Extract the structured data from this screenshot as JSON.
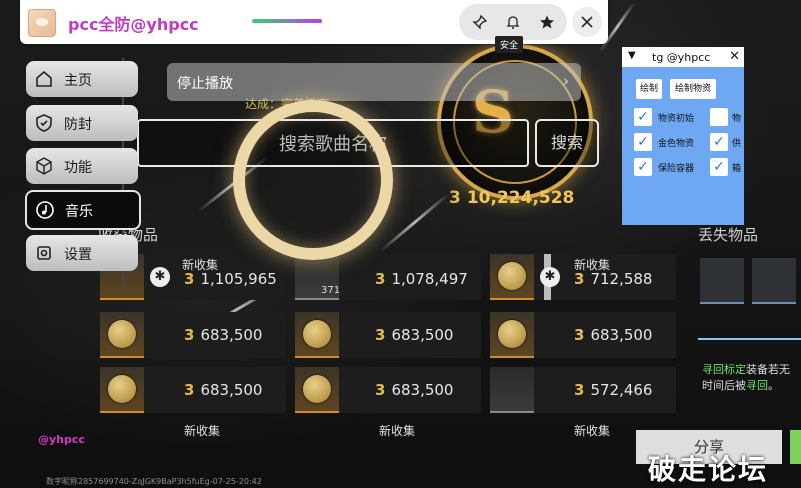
{
  "titlebar": {
    "app_title": "pcc全防@yhpcc",
    "tooltip": "安全",
    "icons": [
      "pin-icon",
      "bell-icon",
      "star-icon",
      "close-icon"
    ]
  },
  "sidebar": {
    "items": [
      {
        "label": "主页",
        "icon": "home-icon",
        "active": false
      },
      {
        "label": "防封",
        "icon": "shield-icon",
        "active": false
      },
      {
        "label": "功能",
        "icon": "cube-icon",
        "active": false
      },
      {
        "label": "音乐",
        "icon": "music-icon",
        "active": true
      },
      {
        "label": "设置",
        "icon": "settings-icon",
        "active": false
      }
    ]
  },
  "music": {
    "stop_label": "停止播放",
    "search_placeholder": "搜索歌曲名称",
    "search_button": "搜索",
    "sub_text": "达成：完美撤离"
  },
  "game": {
    "total_value": "10,224,528",
    "coin_symbol": "3",
    "collected_title": "收获物品",
    "lost_title": "丢失物品",
    "collected": [
      {
        "new": "新收集",
        "value": "1,105,965",
        "icon": "gold-statue-icon"
      },
      {
        "new": "",
        "value": "1,078,497",
        "icon": "baton-icon",
        "count": "371"
      },
      {
        "new": "新收集",
        "value": "712,588",
        "icon": "medal-icon"
      },
      {
        "value": "683,500",
        "icon": "coin-icon"
      },
      {
        "value": "683,500",
        "icon": "coin-icon"
      },
      {
        "value": "683,500",
        "icon": "coin-icon"
      },
      {
        "value": "683,500",
        "icon": "coin-icon"
      },
      {
        "value": "683,500",
        "icon": "coin-icon"
      },
      {
        "value": "572,466",
        "icon": "rifle-icon"
      }
    ],
    "lost_items": [
      "helmet-icon",
      "armor-icon"
    ],
    "retrieve_text_1_prefix": "寻回标定",
    "retrieve_text_1_suffix": "装备若无",
    "retrieve_text_2_prefix": "时间后被",
    "retrieve_text_2_link": "寻回",
    "retrieve_text_2_suffix": "。",
    "bottom_new_label": "新收集"
  },
  "panel": {
    "title": "tg @yhpcc",
    "tabs": [
      "绘制",
      "绘制物资"
    ],
    "options": [
      {
        "label": "物资初始",
        "checked": true
      },
      {
        "label": "金色物资",
        "checked": true
      },
      {
        "label": "保险容器",
        "checked": true
      }
    ],
    "options_right": [
      {
        "label": "物",
        "checked": false
      },
      {
        "label": "供",
        "checked": true
      },
      {
        "label": "箱",
        "checked": true
      }
    ]
  },
  "footer": {
    "tag": "@yhpcc",
    "id_text": "数字昵称2857699740-ZqJGK9BaP3h5fuEg-07-25-20:42",
    "share_label": "分享",
    "watermark": "破走论坛"
  },
  "colors": {
    "accent_purple": "#c13ac6",
    "gold": "#e6b94f",
    "panel_blue": "#6ea8f3",
    "green_link": "#6ee26e"
  }
}
